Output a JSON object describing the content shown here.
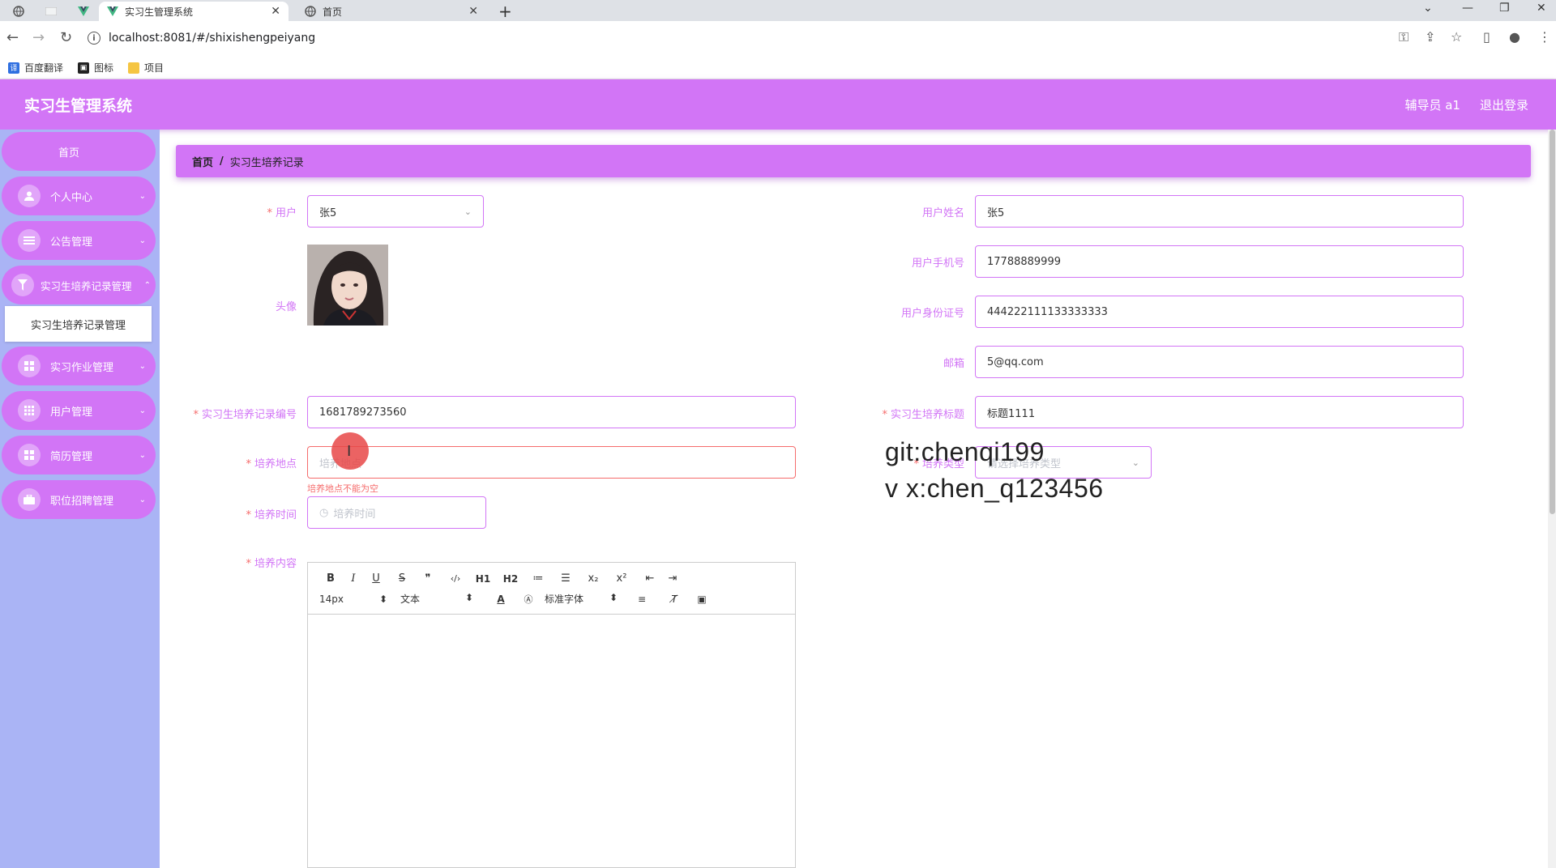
{
  "browser": {
    "tabs": [
      {
        "title": "实习生管理系统",
        "active": true
      },
      {
        "title": "首页",
        "active": false
      }
    ],
    "url": "localhost:8081/#/shixishengpeiyang",
    "bookmarks": [
      "百度翻译",
      "图标",
      "项目"
    ]
  },
  "header": {
    "title": "实习生管理系统",
    "user": "辅导员 a1",
    "logout": "退出登录"
  },
  "sidebar": {
    "home": "首页",
    "items": [
      {
        "label": "个人中心",
        "icon": "user-icon"
      },
      {
        "label": "公告管理",
        "icon": "list-icon"
      },
      {
        "label": "实习生培养记录管理",
        "icon": "funnel-icon"
      },
      {
        "label": "实习作业管理",
        "icon": "grid-icon"
      },
      {
        "label": "用户管理",
        "icon": "grid-icon"
      },
      {
        "label": "简历管理",
        "icon": "grid-icon"
      },
      {
        "label": "职位招聘管理",
        "icon": "briefcase-icon"
      }
    ],
    "submenu": "实习生培养记录管理"
  },
  "breadcrumb": {
    "home": "首页",
    "separator": "/",
    "current": "实习生培养记录"
  },
  "form": {
    "user_label": "用户",
    "user_value": "张5",
    "avatar_label": "头像",
    "name_label": "用户姓名",
    "name_value": "张5",
    "phone_label": "用户手机号",
    "phone_value": "17788889999",
    "idcard_label": "用户身份证号",
    "idcard_value": "444222111133333333",
    "email_label": "邮箱",
    "email_value": "5@qq.com",
    "record_no_label": "实习生培养记录编号",
    "record_no_value": "1681789273560",
    "title_label": "实习生培养标题",
    "title_value": "标题1111",
    "location_label": "培养地点",
    "location_placeholder": "培养地点",
    "location_error": "培养地点不能为空",
    "type_label": "培养类型",
    "type_placeholder": "请选择培养类型",
    "time_label": "培养时间",
    "time_placeholder": "培养时间",
    "content_label": "培养内容"
  },
  "editor": {
    "toolbar_row1": [
      "B",
      "I",
      "U",
      "S",
      "❞",
      "‹/›",
      "H1",
      "H2",
      "≔",
      "☰",
      "x₂",
      "x²",
      "⇤",
      "⇥"
    ],
    "font_size": "14px",
    "paragraph": "文本",
    "font_family": "标准字体"
  },
  "watermark": {
    "line1": "git:chenqi199",
    "line2": "v x:chen_q123456"
  },
  "colors": {
    "accent": "#d275f6",
    "sidebar_bg": "#aab4f5",
    "error": "#f56c6c"
  }
}
